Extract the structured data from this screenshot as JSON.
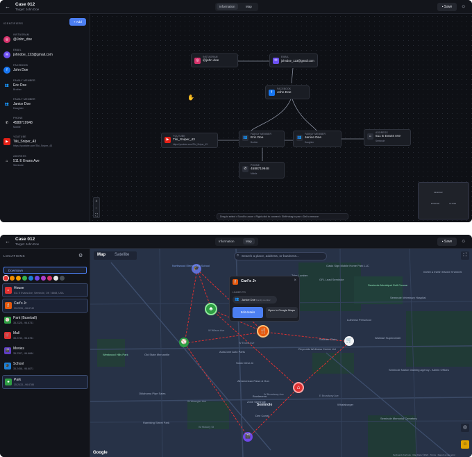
{
  "header": {
    "back": "←",
    "case_title": "Case 012",
    "target": "Target: John Doe",
    "tabs": [
      "Information",
      "Map"
    ],
    "save": "Save",
    "save_icon": "💾"
  },
  "graph_view": {
    "sidebar_title": "IDENTIFIERS",
    "add_button": "+ Add",
    "identifiers": [
      {
        "type": "INSTAGRAM",
        "value": "@John_doe",
        "sub": "",
        "icon": "instagram-icon",
        "color": "#d6336c"
      },
      {
        "type": "EMAIL",
        "value": "johndoe_123@gmail.com",
        "sub": "",
        "icon": "email-icon",
        "color": "#6c4ff2"
      },
      {
        "type": "FACEBOOK",
        "value": "John Doe",
        "sub": "",
        "icon": "facebook-icon",
        "color": "#1877f2"
      },
      {
        "type": "FAMILY MEMBER",
        "value": "Eric Doe",
        "sub": "Brother",
        "icon": "family-icon",
        "color": "#3a3f4c"
      },
      {
        "type": "FAMILY MEMBER",
        "value": "Janice Doe",
        "sub": "Daughter",
        "icon": "family-icon",
        "color": "#3a3f4c"
      },
      {
        "type": "PHONE",
        "value": "4588719948",
        "sub": "Mobile",
        "icon": "phone-icon",
        "color": "#3a3f4c"
      },
      {
        "type": "YOUTUBE",
        "value": "Tiki_Sniper_43",
        "sub": "https://youtube.com/Tiki_Sniper_43",
        "icon": "youtube-icon",
        "color": "#e62117"
      },
      {
        "type": "ADDRESS",
        "value": "511 E Evans Ave",
        "sub": "Seminole",
        "icon": "home-icon",
        "color": "#3a3f4c"
      }
    ],
    "nodes": [
      {
        "id": "ig",
        "type": "INSTAGRAM",
        "value": "@john doe",
        "sub": "",
        "color": "#d6336c"
      },
      {
        "id": "email",
        "type": "EMAIL",
        "value": "johndoe_123@gmail.com",
        "sub": "",
        "color": "#6c4ff2"
      },
      {
        "id": "fb",
        "type": "FACEBOOK",
        "value": "John Doe",
        "sub": "",
        "color": "#1877f2"
      },
      {
        "id": "yt",
        "type": "YOUTUBE",
        "value": "Tiki_Sniper_43",
        "sub": "https://youtube.com/Tiki_Sniper_43",
        "color": "#e62117"
      },
      {
        "id": "eric",
        "type": "FAMILY MEMBER",
        "value": "Eric Doe",
        "sub": "Brother",
        "color": "#3a3f4c"
      },
      {
        "id": "janice",
        "type": "FAMILY MEMBER",
        "value": "Janice Doe",
        "sub": "Daughter",
        "color": "#3a3f4c"
      },
      {
        "id": "addr",
        "type": "ADDRESS",
        "value": "511 E Evans Ave",
        "sub": "Seminole",
        "color": "#3a3f4c"
      },
      {
        "id": "phone",
        "type": "PHONE",
        "value": "4588719948",
        "sub": "Mobile",
        "color": "#3a3f4c"
      }
    ],
    "zoom_controls": [
      "+",
      "−",
      "⛶"
    ],
    "hints": "Drag to select • Scroll to zoom • Right-click to connect • Shift+drag to pan • Del to remove",
    "minimap_labels": [
      "MINIMAP",
      "EXPAND",
      "CLOSE"
    ]
  },
  "map_view": {
    "panel_title": "LOCATIONS",
    "input_value": "Downtown",
    "colors": [
      "#e03131",
      "#f08c00",
      "#f59f00",
      "#37b24d",
      "#1c7ed6",
      "#7048e8",
      "#ae3ec9",
      "#d6336c",
      "#e8e8e8",
      "#495057"
    ],
    "locations": [
      {
        "name": "House",
        "coords": "511 E Evans Ave, Seminole, OK 74868, USA",
        "selected": true,
        "icon": "home-icon",
        "color": "#e03131"
      },
      {
        "name": "Carl's Jr",
        "coords": "35.2395, -96.6740",
        "selected": true,
        "icon": "restaurant-icon",
        "color": "#e8590c"
      },
      {
        "name": "Park (Baseball)",
        "coords": "35.2325, -96.6731",
        "selected": false,
        "icon": "baseball-icon",
        "color": "#2f9e44"
      },
      {
        "name": "Mall",
        "coords": "35.2740, -96.6781",
        "selected": false,
        "icon": "cart-icon",
        "color": "#e03131"
      },
      {
        "name": "Movies",
        "coords": "35.2307, -96.6684",
        "selected": false,
        "icon": "movie-icon",
        "color": "#5f3dc4"
      },
      {
        "name": "School",
        "coords": "35.2458, -96.6871",
        "selected": false,
        "icon": "school-icon",
        "color": "#1c7ed6"
      },
      {
        "name": "Park",
        "coords": "35.2433, -96.6786",
        "selected": true,
        "icon": "park-icon",
        "color": "#2f9e44"
      }
    ],
    "map_tabs": [
      "Map",
      "Satellite"
    ],
    "search_placeholder": "Search a place, address, or business...",
    "popup": {
      "title": "Carl's Jr",
      "linked_label": "LINKED TO",
      "linked_name": "Janice Doe",
      "linked_relation": "Family member",
      "edit_button": "Edit details",
      "open_button": "Open in Google Maps"
    },
    "map_labels": [
      "Northwood Elementary School",
      "Oasis Sign Mobile Home Park LLC",
      "Tyler Lumber",
      "GFL Lead Seminole",
      "Seminole Municipal Golf Course",
      "Seminole Veterinary Hospital",
      "Lutheran Preschool",
      "Walmart Supercenter",
      "KWSH & KWSH RADIO STUDIOS",
      "Westwood Hills Park",
      "Old State Mercantile",
      "AutoZone Auto Parts",
      "Sonic Drive-In",
      "All American Pawn & Gun",
      "Bowlarama",
      "Zone Seminole",
      "Reynolds Wellness Center Ltd",
      "Seminole Nation Gaming Agency - Admin Offices",
      "Oklahoma Pipe Sales",
      "Rambling Street Park",
      "Dee Corral",
      "Seminole Memorial Cemetery",
      "Whataburger",
      "Strother Clinic"
    ],
    "streets": [
      "W Broadway Ave",
      "E Broadway Ave",
      "W Wrangler Ave",
      "W Wilson Ave",
      "W Evans Ave",
      "W Hickory St",
      "Seminole"
    ],
    "google": "Google",
    "footer": "Keyboard shortcuts · Map Data ©2024 · Terms · Report a map error"
  }
}
